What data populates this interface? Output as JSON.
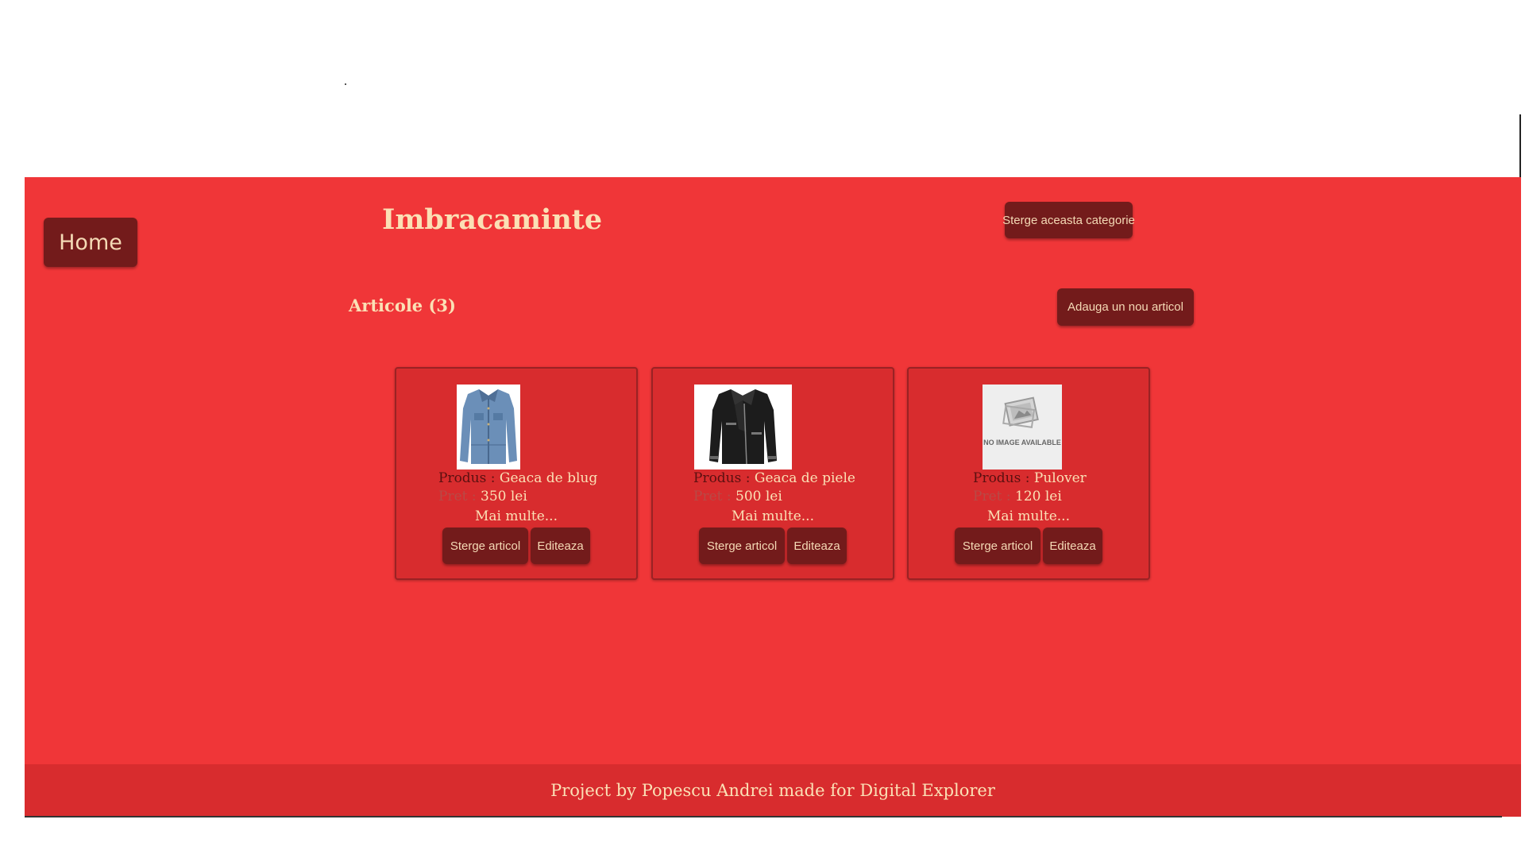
{
  "colors": {
    "page_bg": "#ffffff",
    "main_bg": "#f03638",
    "card_bg": "#d82c2e",
    "button_bg": "#731b1b",
    "accent_text": "#fbe0b5"
  },
  "nav": {
    "home_label": "Home"
  },
  "category": {
    "title": "Imbracaminte",
    "delete_label": "Sterge aceasta categorie"
  },
  "articles": {
    "heading": "Articole (3)",
    "add_label": "Adauga un nou articol",
    "product_label": "Produs :",
    "price_label": "Pret :",
    "more_label": "Mai multe...",
    "delete_label": "Sterge articol",
    "edit_label": "Editeaza",
    "items": [
      {
        "name": "Geaca de blug",
        "price": "350 lei",
        "image": "denim-jacket-icon"
      },
      {
        "name": "Geaca de piele",
        "price": "500 lei",
        "image": "leather-jacket-icon"
      },
      {
        "name": "Pulover",
        "price": "120 lei",
        "image": "no-image-placeholder",
        "placeholder_text": "NO IMAGE AVAILABLE"
      }
    ]
  },
  "footer": {
    "text": "Project by Popescu Andrei made for Digital Explorer"
  }
}
